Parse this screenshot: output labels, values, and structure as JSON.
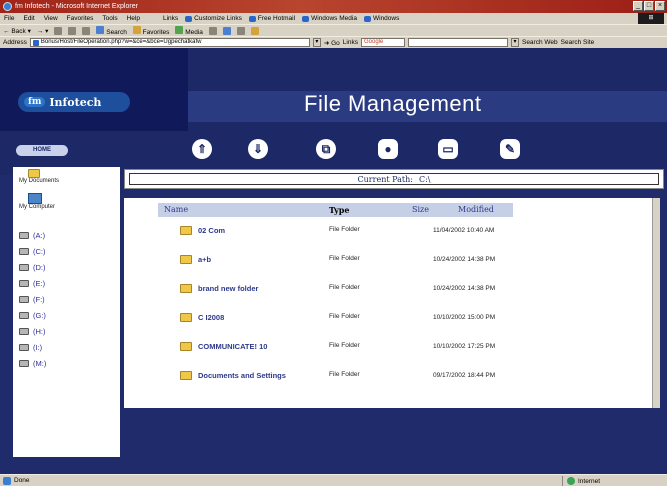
{
  "window": {
    "title": "fm Infotech - Microsoft Internet Explorer",
    "controls": [
      "_",
      "□",
      "×"
    ]
  },
  "menubar": {
    "items": [
      "File",
      "Edit",
      "View",
      "Favorites",
      "Tools",
      "Help"
    ],
    "links_label": "Links",
    "links": [
      "Customize Links",
      "Free Hotmail",
      "Windows Media",
      "Windows"
    ]
  },
  "toolbar": {
    "back": "Back",
    "search": "Search",
    "favorites": "Favorites",
    "media": "Media"
  },
  "addressbar": {
    "label": "Address",
    "url": "Bonus/Host/FileOperation.php?w=&ce=&bce=Ugpechatkafw",
    "go": "Go",
    "links": "Links",
    "google": "Google",
    "search_web": "Search Web",
    "search_site": "Search Site"
  },
  "banner": {
    "logo_prefix": "fm",
    "logo_text": "Infotech",
    "title": "File Management"
  },
  "nav": {
    "home": "HOME"
  },
  "sidebar": {
    "my_documents": "My Documents",
    "my_computer": "My Computer",
    "drives": [
      "(A:)",
      "(C:)",
      "(D:)",
      "(E:)",
      "(F:)",
      "(G:)",
      "(H:)",
      "(I:)",
      "(M:)"
    ]
  },
  "path": {
    "label": "Current Path:",
    "value": "C:\\"
  },
  "files": {
    "headers": {
      "name": "Name",
      "type": "Type",
      "size": "Size",
      "modified": "Modified"
    },
    "rows": [
      {
        "name": "02 Com",
        "type": "File Folder",
        "modified": "11/04/2002 10:40 AM"
      },
      {
        "name": "a+b",
        "type": "File Folder",
        "modified": "10/24/2002 14:38 PM"
      },
      {
        "name": "brand new folder",
        "type": "File Folder",
        "modified": "10/24/2002 14:38 PM"
      },
      {
        "name": "C I2008",
        "type": "File Folder",
        "modified": "10/10/2002 15:00 PM"
      },
      {
        "name": "COMMUNICATE! 10",
        "type": "File Folder",
        "modified": "10/10/2002 17:25 PM"
      },
      {
        "name": "Documents and Settings",
        "type": "File Folder",
        "modified": "09/17/2002 18:44 PM"
      }
    ]
  },
  "status": {
    "left": "Done",
    "zone": "Internet"
  }
}
